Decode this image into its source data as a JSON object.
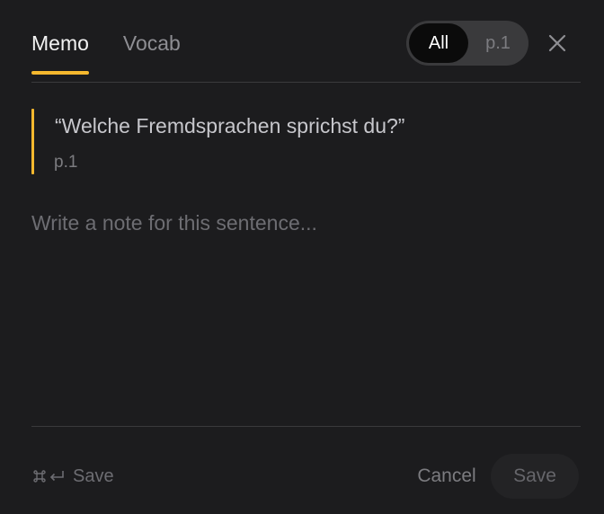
{
  "tabs": [
    {
      "label": "Memo",
      "active": true
    },
    {
      "label": "Vocab",
      "active": false
    }
  ],
  "scope_toggle": {
    "options": [
      "All",
      "p.1"
    ],
    "selected": "All"
  },
  "quote": {
    "text": "“Welche Fremdsprachen sprichst du?”",
    "page": "p.1"
  },
  "note": {
    "value": "",
    "placeholder": "Write a note for this sentence..."
  },
  "footer": {
    "shortcut_label": "Save",
    "shortcut_icons": [
      "command-icon",
      "return-icon"
    ],
    "cancel_label": "Cancel",
    "save_label": "Save"
  },
  "colors": {
    "background": "#1c1c1e",
    "accent": "#f5b82e",
    "text_primary": "#f2f2f2",
    "text_muted": "#8e8e93",
    "divider": "#3a3a3c"
  },
  "icons": {
    "close": "close-icon"
  }
}
